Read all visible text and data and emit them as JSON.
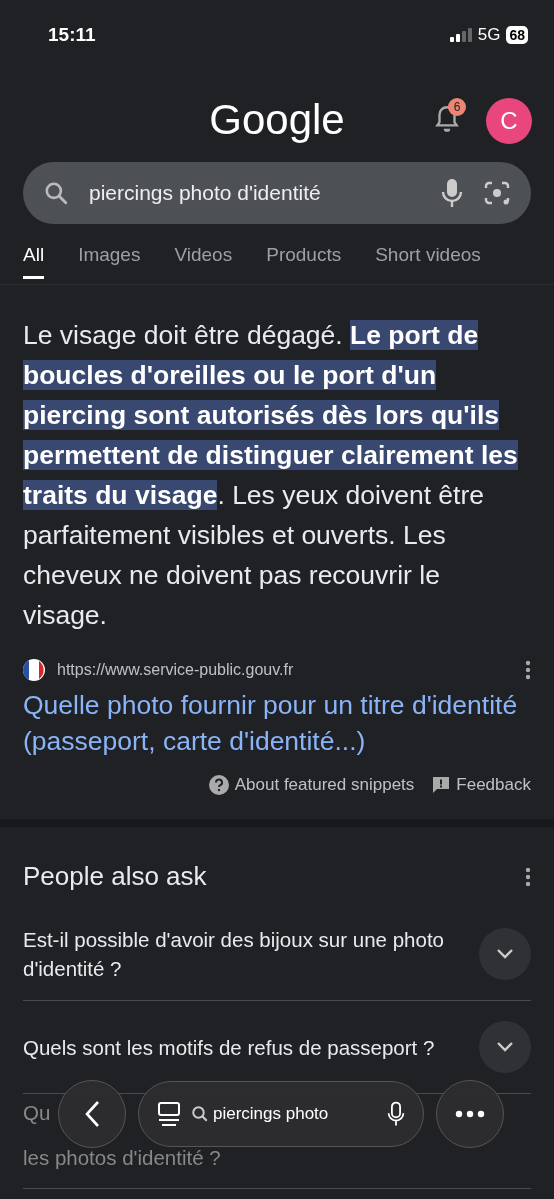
{
  "status_bar": {
    "time": "15:11",
    "network": "5G",
    "battery": "68"
  },
  "header": {
    "logo": "Google",
    "notifications": "6",
    "avatar": "C"
  },
  "search": {
    "value": "piercings photo d'identité"
  },
  "tabs": [
    {
      "label": "All",
      "selected": true
    },
    {
      "label": "Images",
      "selected": false
    },
    {
      "label": "Videos",
      "selected": false
    },
    {
      "label": "Products",
      "selected": false
    },
    {
      "label": "Short videos",
      "selected": false
    }
  ],
  "snippet": {
    "parts": [
      {
        "text": "Le visage doit être dégagé. ",
        "highlighted": false
      },
      {
        "text": "Le port de boucles d'oreilles ou le port d'un piercing sont autorisés dès lors qu'ils permettent de distinguer clairement les traits du visage",
        "highlighted": true
      },
      {
        "text": ". Les yeux doivent être parfaitement visibles et ouverts. Les cheveux ne doivent pas recouvrir le visage.",
        "highlighted": false
      }
    ],
    "url": "https://www.service-public.gouv.fr",
    "title": "Quelle photo fournir pour un titre d'identité (passeport, carte d'identité...)",
    "about": "About featured snippets",
    "feedback": "Feedback"
  },
  "people_also_ask": {
    "title": "People also ask",
    "questions": [
      {
        "text": "Est-il possible d'avoir des bijoux sur une photo d'identité ?"
      },
      {
        "text": "Quels sont les motifs de refus de passeport ?"
      }
    ],
    "partial_question": {
      "line_1": "Qu",
      "line_2": "les photos d'identité ?"
    }
  },
  "bottom_bar": {
    "query": "piercings photo"
  }
}
